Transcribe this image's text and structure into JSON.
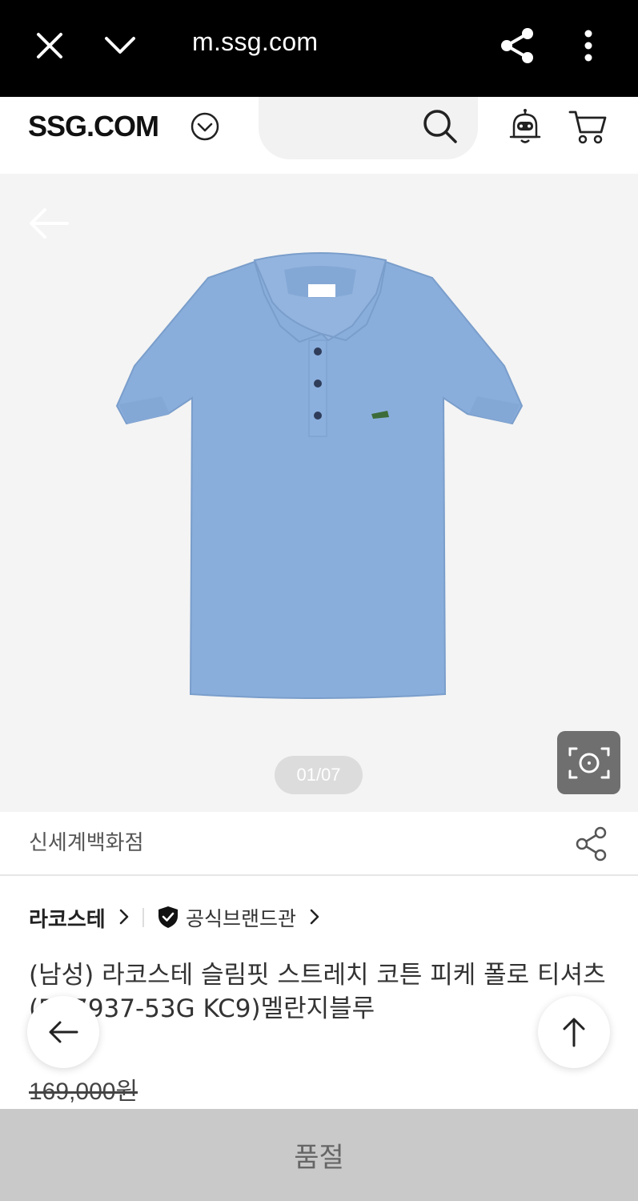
{
  "browser": {
    "url": "m.ssg.com",
    "icons": [
      "close-icon",
      "chevron-down-icon",
      "share-icon",
      "more-vertical-icon"
    ]
  },
  "header": {
    "logo": "SSG.COM",
    "icons": [
      "chevron-circle-down-icon",
      "search-icon",
      "robot-bell-icon",
      "cart-icon"
    ]
  },
  "gallery": {
    "page_counter": "01/07",
    "icons": [
      "back-arrow-icon",
      "lens-search-icon"
    ],
    "product_color": "#8aaedc"
  },
  "seller": {
    "name": "신세계백화점"
  },
  "brand": {
    "name": "라코스테",
    "official_label": "공식브랜드관"
  },
  "product": {
    "title": "(남성) 라코스테 슬림핏 스트레치 코튼 피케 폴로 티셔츠(PH7937-53G KC9)멜란지블루",
    "original_price": "169,000원"
  },
  "bottom_bar": {
    "label": "품절"
  },
  "colors": {
    "browser_bar": "#000000",
    "soldout_bg": "#c9c9c9",
    "gallery_bg": "#f4f4f4"
  }
}
